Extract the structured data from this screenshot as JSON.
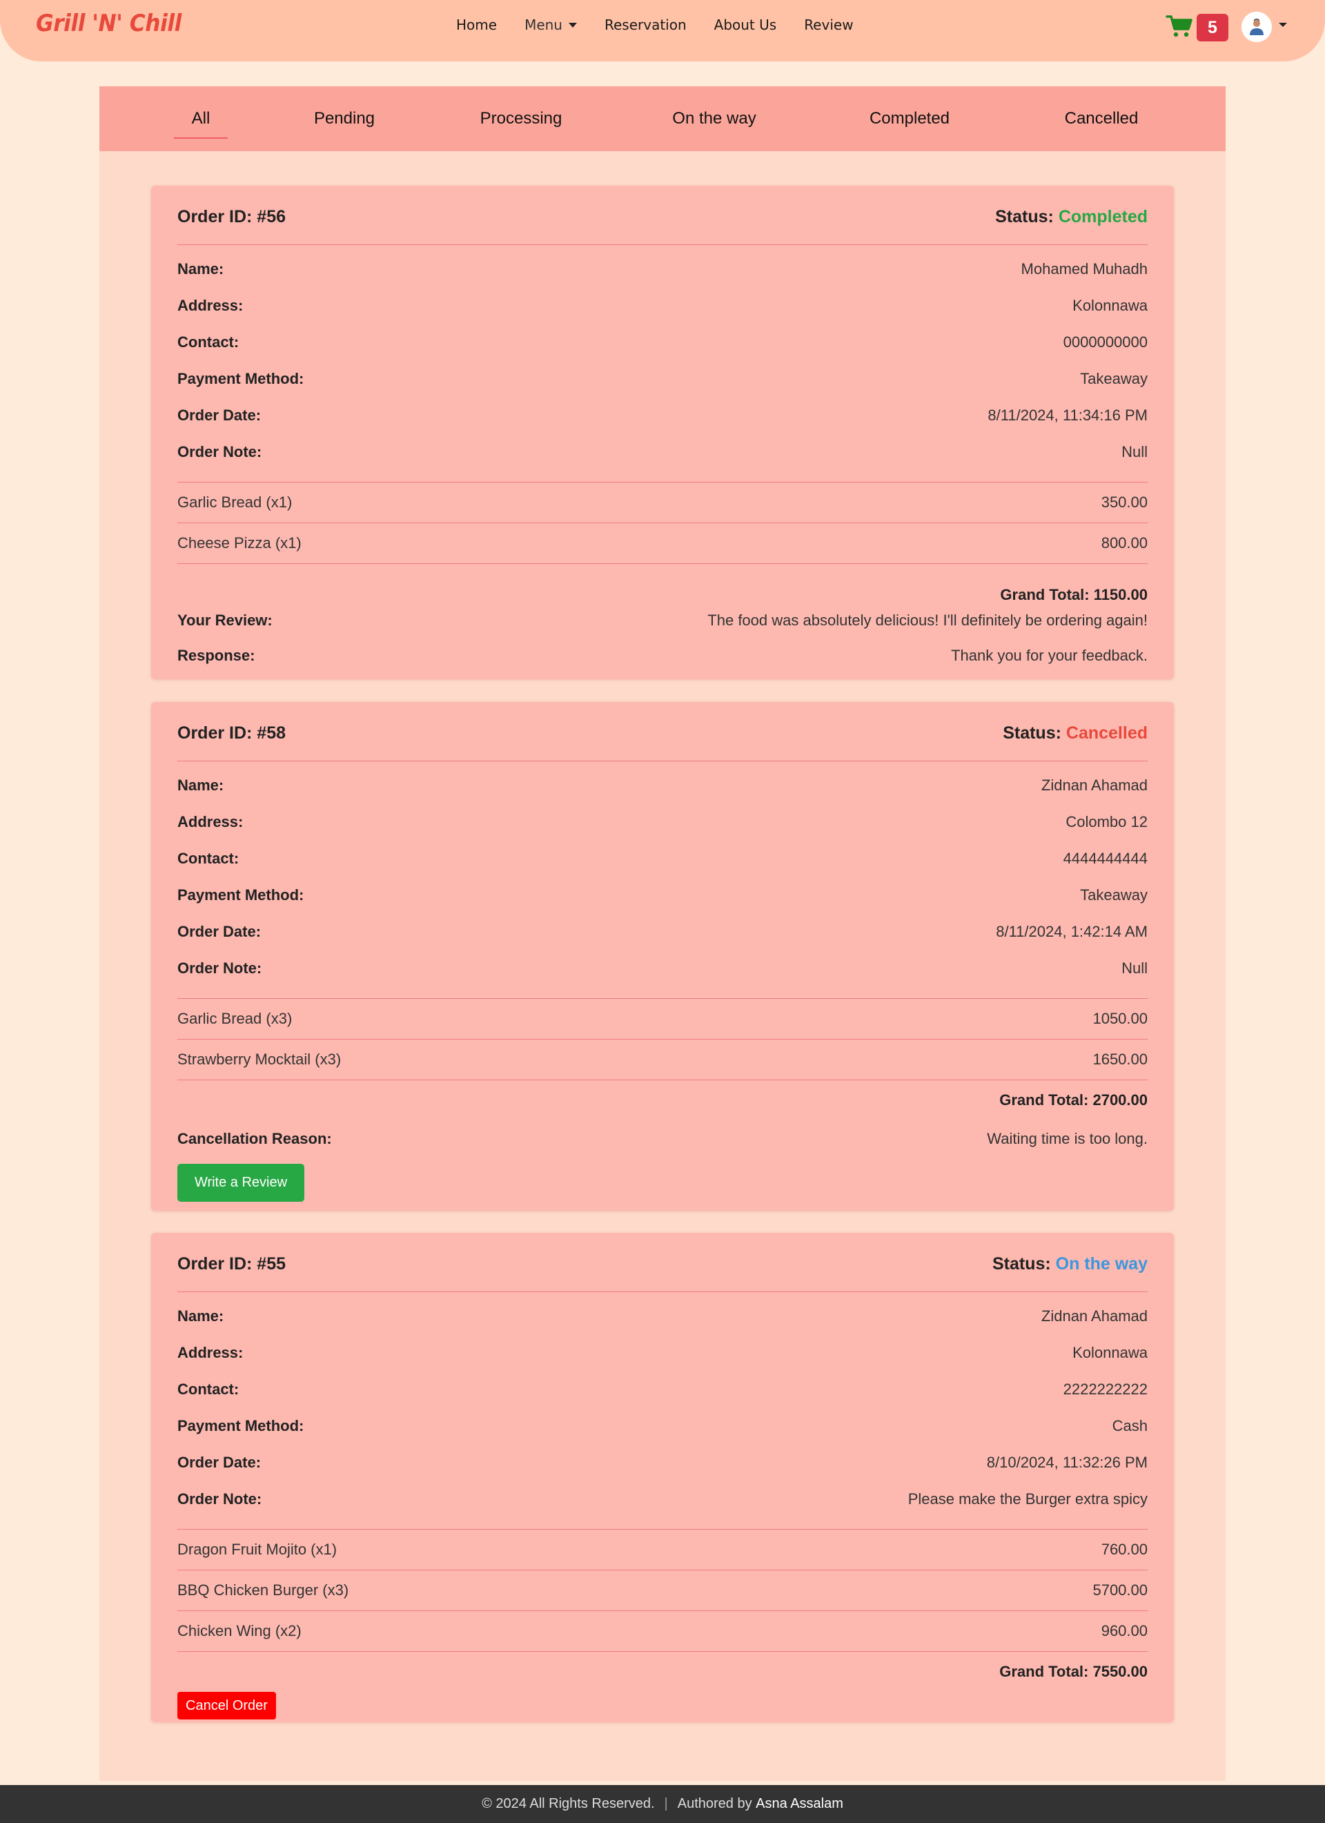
{
  "brand": "Grill 'N' Chill",
  "nav": {
    "home": "Home",
    "menu": "Menu",
    "reservation": "Reservation",
    "about": "About Us",
    "review": "Review"
  },
  "cart": {
    "count": "5"
  },
  "colors": {
    "accent": "#e8493c",
    "completed": "#28a745",
    "cancelled": "#e8493c",
    "on_the_way": "#3b96e0",
    "badge": "#dc3545"
  },
  "tabs": [
    "All",
    "Pending",
    "Processing",
    "On the way",
    "Completed",
    "Cancelled"
  ],
  "active_tab": "All",
  "labels": {
    "status": "Status:",
    "name": "Name:",
    "address": "Address:",
    "contact": "Contact:",
    "payment": "Payment Method:",
    "date": "Order Date:",
    "note": "Order Note:",
    "your_review": "Your Review:",
    "response": "Response:",
    "cancel_reason": "Cancellation Reason:"
  },
  "orders": [
    {
      "id": "Order ID: #56",
      "status": "Completed",
      "name": "Mohamed Muhadh",
      "address": "Kolonnawa",
      "contact": "0000000000",
      "payment": "Takeaway",
      "date": "8/11/2024, 11:34:16 PM",
      "note": "Null",
      "items": [
        {
          "name": "Garlic Bread (x1)",
          "price": "350.00"
        },
        {
          "name": "Cheese Pizza (x1)",
          "price": "800.00"
        }
      ],
      "grand_total": "Grand Total: 1150.00",
      "review": "The food was absolutely delicious! I'll definitely be ordering again!",
      "response": "Thank you for your feedback."
    },
    {
      "id": "Order ID: #58",
      "status": "Cancelled",
      "name": "Zidnan Ahamad",
      "address": "Colombo 12",
      "contact": "4444444444",
      "payment": "Takeaway",
      "date": "8/11/2024, 1:42:14 AM",
      "note": "Null",
      "items": [
        {
          "name": "Garlic Bread (x3)",
          "price": "1050.00"
        },
        {
          "name": "Strawberry Mocktail (x3)",
          "price": "1650.00"
        }
      ],
      "grand_total": "Grand Total: 2700.00",
      "cancel_reason": "Waiting time is too long.",
      "button": "Write a Review"
    },
    {
      "id": "Order ID: #55",
      "status": "On the way",
      "name": "Zidnan Ahamad",
      "address": "Kolonnawa",
      "contact": "2222222222",
      "payment": "Cash",
      "date": "8/10/2024, 11:32:26 PM",
      "note": "Please make the Burger extra spicy",
      "items": [
        {
          "name": "Dragon Fruit Mojito (x1)",
          "price": "760.00"
        },
        {
          "name": "BBQ Chicken Burger (x3)",
          "price": "5700.00"
        },
        {
          "name": "Chicken Wing (x2)",
          "price": "960.00"
        }
      ],
      "grand_total": "Grand Total: 7550.00",
      "button": "Cancel Order"
    }
  ],
  "footer": {
    "copyright": "© 2024 All Rights Reserved.",
    "separator": "|",
    "authored_by": "Authored by",
    "author": "Asna Assalam"
  }
}
